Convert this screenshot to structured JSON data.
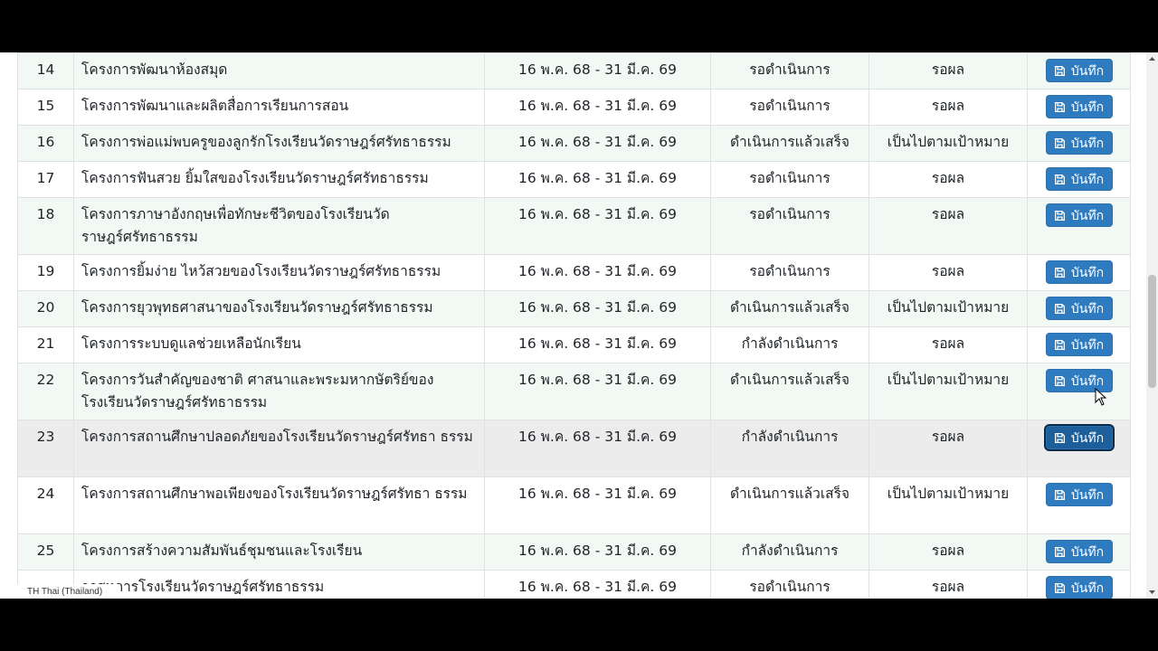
{
  "table": {
    "rows": [
      {
        "no": "14",
        "name": "โครงการพัฒนาห้องสมุด",
        "date": "16 พ.ค. 68 - 31 มี.ค. 69",
        "status": "รอดำเนินการ",
        "result": "รอผล",
        "button": "บันทึก"
      },
      {
        "no": "15",
        "name": "โครงการพัฒนาและผลิตสื่อการเรียนการสอน",
        "date": "16 พ.ค. 68 - 31 มี.ค. 69",
        "status": "รอดำเนินการ",
        "result": "รอผล",
        "button": "บันทึก"
      },
      {
        "no": "16",
        "name": "โครงการพ่อแม่พบครูของลูกรักโรงเรียนวัดราษฎร์ศรัทธาธรรม",
        "date": "16 พ.ค. 68 - 31 มี.ค. 69",
        "status": "ดำเนินการแล้วเสร็จ",
        "result": "เป็นไปตามเป้าหมาย",
        "button": "บันทึก"
      },
      {
        "no": "17",
        "name": "โครงการฟันสวย ยิ้มใสของโรงเรียนวัดราษฎร์ศรัทธาธรรม",
        "date": "16 พ.ค. 68 - 31 มี.ค. 69",
        "status": "รอดำเนินการ",
        "result": "รอผล",
        "button": "บันทึก"
      },
      {
        "no": "18",
        "name": "โครงการภาษาอังกฤษเพื่อทักษะชีวิตของโรงเรียนวัด ราษฎร์ศรัทธาธรรม",
        "date": "16 พ.ค. 68 - 31 มี.ค. 69",
        "status": "รอดำเนินการ",
        "result": "รอผล",
        "button": "บันทึก"
      },
      {
        "no": "19",
        "name": "โครงการยิ้มง่าย ไหว้สวยของโรงเรียนวัดราษฎร์ศรัทธาธรรม",
        "date": "16 พ.ค. 68 - 31 มี.ค. 69",
        "status": "รอดำเนินการ",
        "result": "รอผล",
        "button": "บันทึก"
      },
      {
        "no": "20",
        "name": "โครงการยุวพุทธศาสนาของโรงเรียนวัดราษฎร์ศรัทธาธรรม",
        "date": "16 พ.ค. 68 - 31 มี.ค. 69",
        "status": "ดำเนินการแล้วเสร็จ",
        "result": "เป็นไปตามเป้าหมาย",
        "button": "บันทึก"
      },
      {
        "no": "21",
        "name": "โครงการระบบดูแลช่วยเหลือนักเรียน",
        "date": "16 พ.ค. 68 - 31 มี.ค. 69",
        "status": "กำลังดำเนินการ",
        "result": "รอผล",
        "button": "บันทึก"
      },
      {
        "no": "22",
        "name": "โครงการวันสำคัญของชาติ ศาสนาและพระมหากษัตริย์ของ โรงเรียนวัดราษฎร์ศรัทธาธรรม",
        "date": "16 พ.ค. 68 - 31 มี.ค. 69",
        "status": "ดำเนินการแล้วเสร็จ",
        "result": "เป็นไปตามเป้าหมาย",
        "button": "บันทึก"
      },
      {
        "no": "23",
        "name": "โครงการสถานศึกษาปลอดภัยของโรงเรียนวัดราษฎร์ศรัทธา ธรรม",
        "date": "16 พ.ค. 68 - 31 มี.ค. 69",
        "status": "กำลังดำเนินการ",
        "result": "รอผล",
        "button": "บันทึก"
      },
      {
        "no": "24",
        "name": "โครงการสถานศึกษาพอเพียงของโรงเรียนวัดราษฎร์ศรัทธา ธรรม",
        "date": "16 พ.ค. 68 - 31 มี.ค. 69",
        "status": "ดำเนินการแล้วเสร็จ",
        "result": "เป็นไปตามเป้าหมาย",
        "button": "บันทึก"
      },
      {
        "no": "25",
        "name": "โครงการสร้างความสัมพันธ์ชุมชนและโรงเรียน",
        "date": "16 พ.ค. 68 - 31 มี.ค. 69",
        "status": "กำลังดำเนินการ",
        "result": "รอผล",
        "button": "บันทึก"
      },
      {
        "no": "",
        "name": "ารสหการโรงเรียนวัดราษฎร์ศรัทธาธรรม",
        "date": "16 พ.ค. 68 - 31 มี.ค. 69",
        "status": "รอดำเนินการ",
        "result": "รอผล",
        "button": "บันทึก"
      }
    ]
  },
  "taskbar": {
    "language": "TH Thai (Thailand)"
  },
  "colors": {
    "button": "#2f7bbf",
    "row_alt": "#f2f8f4",
    "border": "#dee2e6"
  }
}
